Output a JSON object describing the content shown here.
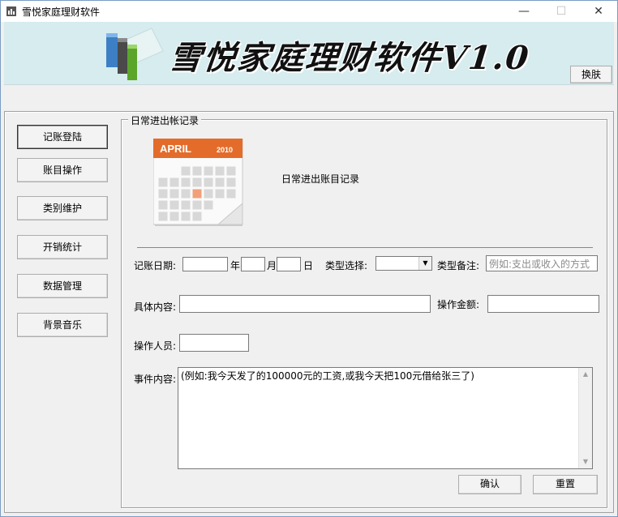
{
  "window": {
    "title": "雪悦家庭理财软件",
    "controls": {
      "minimize": "—",
      "maximize": "☐",
      "close": "✕"
    }
  },
  "banner": {
    "title": "雪悦家庭理财软件V1.0",
    "skin_button": "换肤",
    "logo_icon": "bar-chart-logo-icon"
  },
  "nav": {
    "items": [
      {
        "label": "记账登陆",
        "active": true
      },
      {
        "label": "账目操作",
        "active": false
      },
      {
        "label": "类别维护",
        "active": false
      },
      {
        "label": "开销统计",
        "active": false
      },
      {
        "label": "数据管理",
        "active": false
      },
      {
        "label": "背景音乐",
        "active": false
      }
    ]
  },
  "panel": {
    "legend": "日常进出帐记录",
    "calendar": {
      "month": "APRIL",
      "year": "2010",
      "icon": "calendar-icon"
    },
    "caption": "日常进出账目记录"
  },
  "form": {
    "date_label": "记账日期:",
    "year_unit": "年",
    "month_unit": "月",
    "day_unit": "日",
    "year_value": "",
    "month_value": "",
    "day_value": "",
    "type_select_label": "类型选择:",
    "type_select_value": "",
    "type_note_label": "类型备注:",
    "type_note_value": "例如:支出或收入的方式",
    "content_label": "具体内容:",
    "content_value": "",
    "amount_label": "操作金额:",
    "amount_value": "",
    "operator_label": "操作人员:",
    "operator_value": "",
    "event_label": "事件内容:",
    "event_value": "(例如:我今天发了的100000元的工资,或我今天把100元借给张三了)",
    "confirm": "确认",
    "reset": "重置"
  },
  "colors": {
    "banner_bg": "#d6ecef",
    "calendar_header": "#e36c2a",
    "divider": "#4a9bc3"
  }
}
